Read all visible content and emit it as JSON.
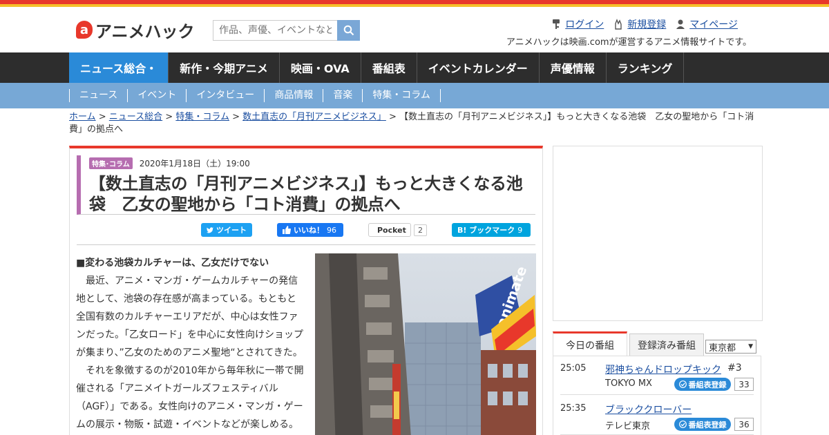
{
  "header": {
    "logo_mark": "a",
    "logo_text": "アニメハック",
    "search_placeholder": "作品、声優、イベントなど",
    "login": "ログイン",
    "signup": "新規登録",
    "mypage": "マイページ",
    "site_desc": "アニメハックは映画.comが運営するアニメ情報サイトです。"
  },
  "mainnav": [
    "ニュース総合・",
    "新作・今期アニメ",
    "映画・OVA",
    "番組表",
    "イベントカレンダー",
    "声優情報",
    "ランキング"
  ],
  "subnav": [
    "ニュース",
    "イベント",
    "インタビュー",
    "商品情報",
    "音楽",
    "特集・コラム"
  ],
  "breadcrumb": {
    "home": "ホーム",
    "news": "ニュース総合",
    "column": "特集・コラム",
    "series": "数土直志の「月刊アニメビジネス」",
    "current": "【数土直志の「月刊アニメビジネス」】もっと大きくなる池袋　乙女の聖地から「コト消費」の拠点へ",
    "sep": " > "
  },
  "article": {
    "category": "特集･コラム",
    "date": "2020年1月18日（土）19:00",
    "title": "【数土直志の「月刊アニメビジネス」】もっと大きくなる池袋　乙女の聖地から「コト消費」の拠点へ",
    "lead": "■変わる池袋カルチャーは、乙女だけでない",
    "para1": "最近、アニメ・マンガ・ゲームカルチャーの発信地として、池袋の存在感が高まっている。もともと全国有数のカルチャーエリアだが、中心は女性ファンだった。「乙女ロード」を中心に女性向けショップが集まり、”乙女のためのアニメ聖地“とされてきた。",
    "para2": "それを象徴するのが2010年から毎年秋に一帯で開催される「アニメイトガールズフェスティバル（AGF）」である。女性向けのアニメ・マンガ・ゲームの展示・物販・試遊・イベントなどが楽しめる。"
  },
  "share": {
    "tweet": "ツイート",
    "like": "いいね！",
    "like_count": "96",
    "pocket": "Pocket",
    "pocket_count": "2",
    "hatena": "B! ブックマーク",
    "hatena_count": "9"
  },
  "tv": {
    "tab_today": "今日の番組",
    "tab_registered": "登録済み番組",
    "region": "東京都",
    "register_label": "番組表登録",
    "rows": [
      {
        "time": "25:05",
        "title": "邪神ちゃんドロップキック",
        "ep": "#3",
        "channel": "TOKYO MX",
        "count": "33"
      },
      {
        "time": "25:35",
        "title": "ブラッククローバー",
        "ep": "",
        "channel": "テレビ東京",
        "count": "36"
      }
    ]
  },
  "colors": {
    "brand_red": "#e8382b",
    "accent_blue": "#2a8ad8",
    "subnav_blue": "#77a8d6",
    "category_purple": "#b66db0"
  },
  "icons": [
    "search-icon",
    "login-key-icon",
    "signup-hand-icon",
    "mypage-person-icon",
    "twitter-icon",
    "facebook-like-icon",
    "pocket-icon",
    "check-circle-icon"
  ]
}
